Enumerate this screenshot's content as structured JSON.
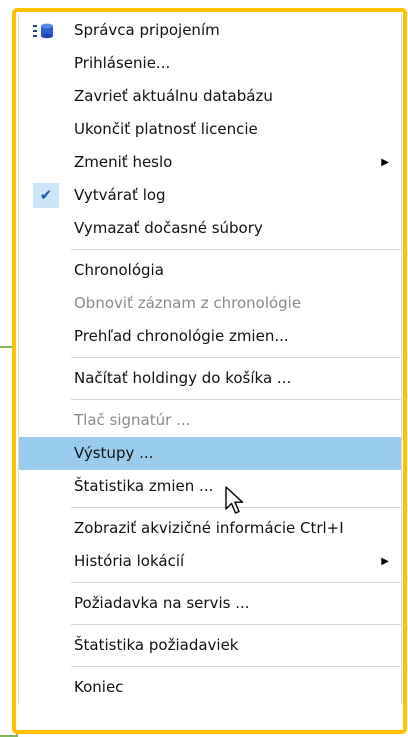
{
  "menu": {
    "groups": [
      {
        "items": [
          {
            "label": "Správca pripojením",
            "icon": "database-connection-icon"
          },
          {
            "label": "Prihlásenie..."
          },
          {
            "label": "Zavrieť aktuálnu databázu"
          },
          {
            "label": "Ukončiť platnosť licencie"
          },
          {
            "label": "Zmeniť heslo",
            "submenu": true
          },
          {
            "label": "Vytvárať log",
            "checked": true
          },
          {
            "label": "Vymazať dočasné súbory"
          }
        ]
      },
      {
        "items": [
          {
            "label": "Chronológia"
          },
          {
            "label": "Obnoviť záznam z chronológie",
            "disabled": true
          },
          {
            "label": "Prehľad chronológie zmien..."
          }
        ]
      },
      {
        "items": [
          {
            "label": "Načítať holdingy do košíka ..."
          }
        ]
      },
      {
        "items": [
          {
            "label": "Tlač signatúr ...",
            "disabled": true
          },
          {
            "label": "Výstupy ...",
            "highlighted": true
          },
          {
            "label": "Štatistika zmien ..."
          }
        ]
      },
      {
        "items": [
          {
            "label": "Zobraziť akvizičné informácie Ctrl+I"
          },
          {
            "label": "História lokácií",
            "submenu": true
          }
        ]
      },
      {
        "items": [
          {
            "label": "Požiadavka na servis ..."
          }
        ]
      },
      {
        "items": [
          {
            "label": "Štatistika požiadaviek"
          }
        ]
      },
      {
        "items": [
          {
            "label": "Koniec"
          }
        ]
      }
    ]
  },
  "colors": {
    "highlight": "#99ccee",
    "frame": "#ffc100",
    "side_panel": "#7fb65a",
    "disabled_text": "#8a8a8a"
  }
}
